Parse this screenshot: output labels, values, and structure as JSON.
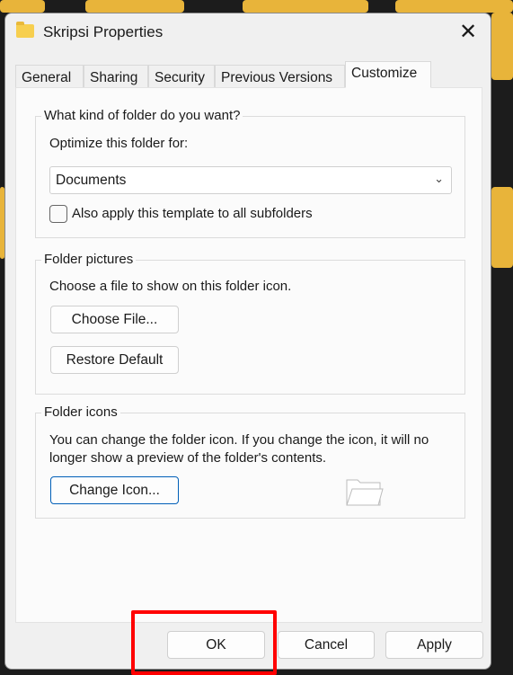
{
  "window": {
    "title": "Skripsi Properties",
    "icon": "folder-icon",
    "close_icon": "close-icon"
  },
  "tabs": [
    {
      "label": "General"
    },
    {
      "label": "Sharing"
    },
    {
      "label": "Security"
    },
    {
      "label": "Previous Versions"
    },
    {
      "label": "Customize",
      "active": true
    }
  ],
  "folder_type": {
    "heading": "What kind of folder do you want?",
    "optimize_label": "Optimize this folder for:",
    "selected": "Documents",
    "apply_subfolders_label": "Also apply this template to all subfolders",
    "apply_subfolders_checked": false
  },
  "folder_pictures": {
    "heading": "Folder pictures",
    "description": "Choose a file to show on this folder icon.",
    "choose_file": "Choose File...",
    "restore_default": "Restore Default"
  },
  "folder_icons": {
    "heading": "Folder icons",
    "description_line1": "You can change the folder icon. If you change the icon, it will no",
    "description_line2": "longer show a preview of the folder's contents.",
    "change_icon": "Change Icon..."
  },
  "footer": {
    "ok": "OK",
    "cancel": "Cancel",
    "apply": "Apply"
  },
  "colors": {
    "highlight": "#ff0000",
    "focus_border": "#005fb8"
  }
}
